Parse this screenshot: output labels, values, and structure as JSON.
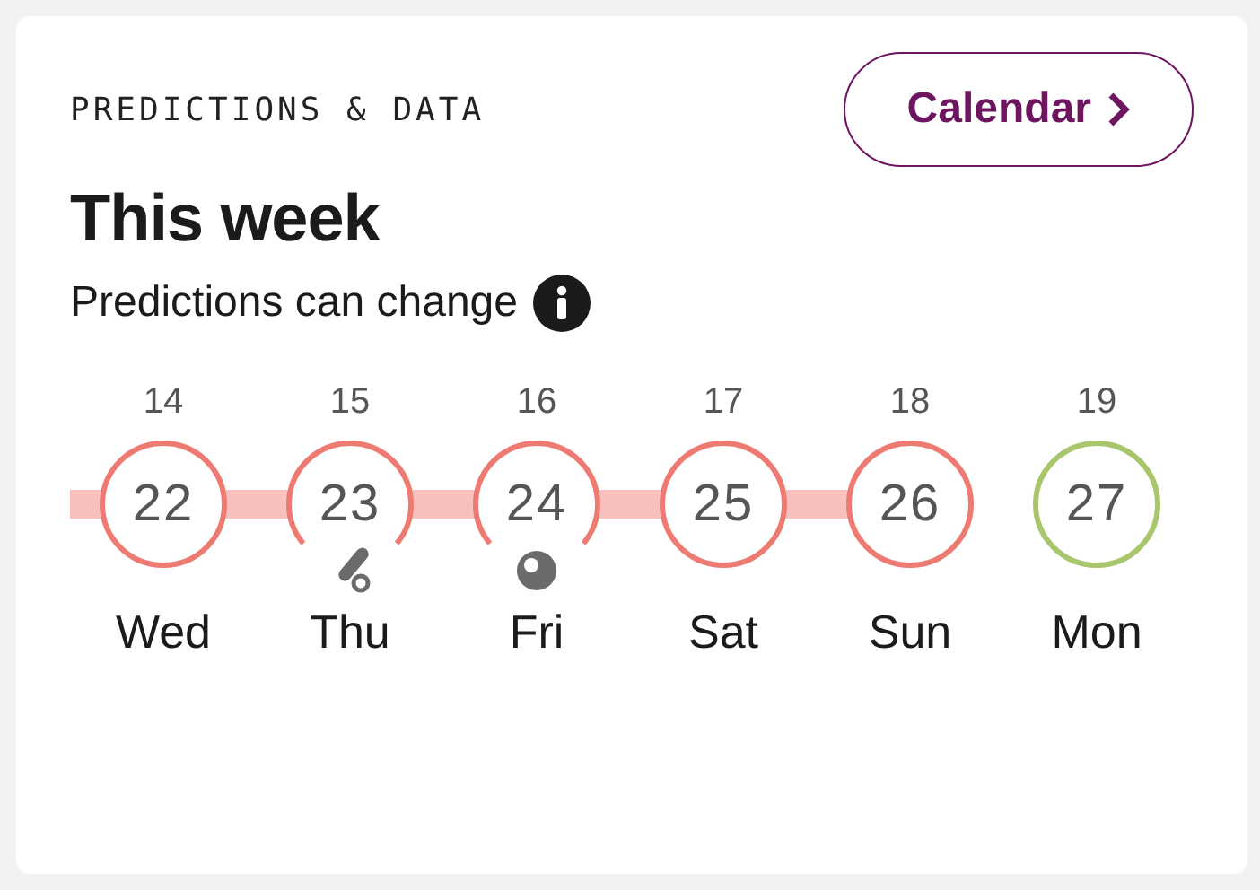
{
  "header": {
    "eyebrow": "PREDICTIONS & DATA",
    "calendar_button": "Calendar"
  },
  "title": "This week",
  "subtitle": "Predictions can change",
  "days": [
    {
      "date": "14",
      "cycle_day": "22",
      "weekday": "Wed",
      "color": "#ee7b72",
      "kind": "plain"
    },
    {
      "date": "15",
      "cycle_day": "23",
      "weekday": "Thu",
      "color": "#ee7b72",
      "kind": "test"
    },
    {
      "date": "16",
      "cycle_day": "24",
      "weekday": "Fri",
      "color": "#ee7b72",
      "kind": "ball"
    },
    {
      "date": "17",
      "cycle_day": "25",
      "weekday": "Sat",
      "color": "#ee7b72",
      "kind": "plain"
    },
    {
      "date": "18",
      "cycle_day": "26",
      "weekday": "Sun",
      "color": "#ee7b72",
      "kind": "plain"
    },
    {
      "date": "19",
      "cycle_day": "27",
      "weekday": "Mon",
      "color": "#a8c66c",
      "kind": "plain"
    }
  ]
}
